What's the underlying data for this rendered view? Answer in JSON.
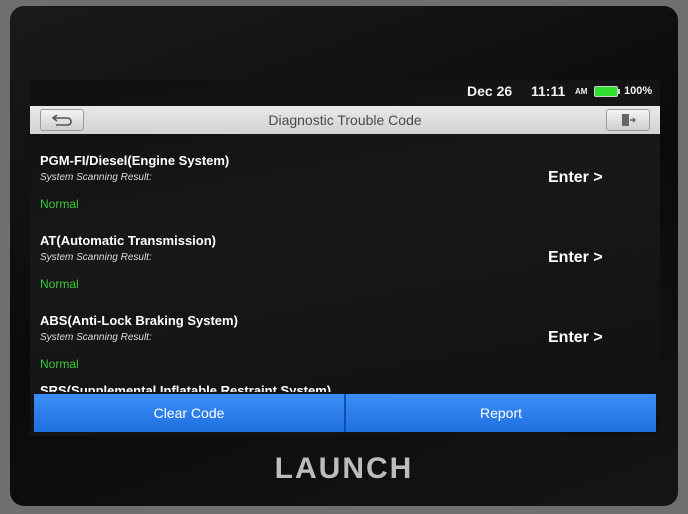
{
  "statusbar": {
    "date": "Dec 26",
    "time": "11:11",
    "ampm": "AM",
    "battery": "100%",
    "battery_level": 1.0
  },
  "header": {
    "title": "Diagnostic Trouble Code"
  },
  "systems": [
    {
      "name": "PGM-FI/Diesel(Engine System)",
      "subtitle": "System Scanning Result:",
      "status": "Normal",
      "action": "Enter >"
    },
    {
      "name": "AT(Automatic Transmission)",
      "subtitle": "System Scanning Result:",
      "status": "Normal",
      "action": "Enter >"
    },
    {
      "name": "ABS(Anti-Lock Braking System)",
      "subtitle": "System Scanning Result:",
      "status": "Normal",
      "action": "Enter >"
    },
    {
      "name": "SRS(Supplemental Inflatable Restraint System)"
    }
  ],
  "actions": {
    "clear_code": "Clear Code",
    "report": "Report"
  },
  "device": {
    "brand": "LAUNCH"
  },
  "colors": {
    "accent_blue": "#2a7ff0",
    "status_green": "#37c837",
    "battery_green": "#2ee02e"
  },
  "icons": {
    "back": "back-arrow-icon",
    "exit": "exit-icon",
    "battery": "battery-icon"
  }
}
